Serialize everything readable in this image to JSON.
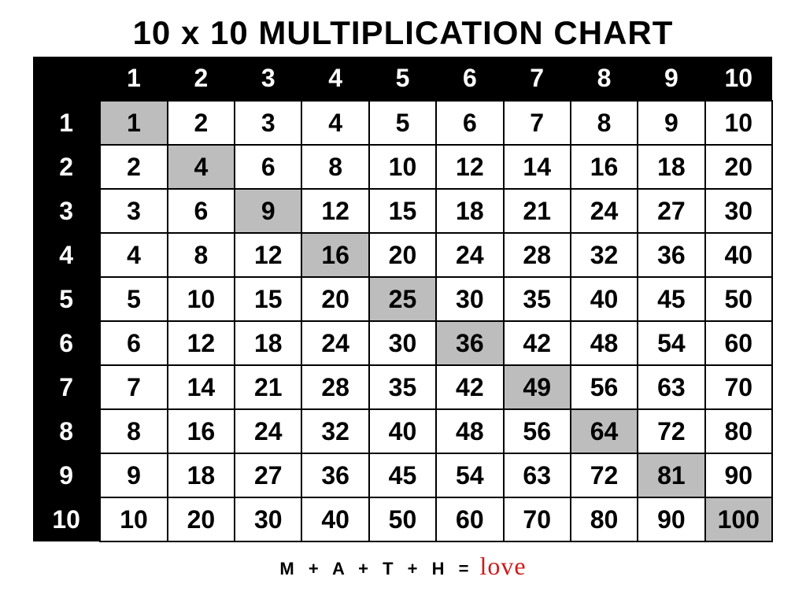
{
  "title": "10 x 10 MULTIPLICATION CHART",
  "size": 10,
  "col_headers": [
    "1",
    "2",
    "3",
    "4",
    "5",
    "6",
    "7",
    "8",
    "9",
    "10"
  ],
  "row_headers": [
    "1",
    "2",
    "3",
    "4",
    "5",
    "6",
    "7",
    "8",
    "9",
    "10"
  ],
  "rows": [
    [
      "1",
      "2",
      "3",
      "4",
      "5",
      "6",
      "7",
      "8",
      "9",
      "10"
    ],
    [
      "2",
      "4",
      "6",
      "8",
      "10",
      "12",
      "14",
      "16",
      "18",
      "20"
    ],
    [
      "3",
      "6",
      "9",
      "12",
      "15",
      "18",
      "21",
      "24",
      "27",
      "30"
    ],
    [
      "4",
      "8",
      "12",
      "16",
      "20",
      "24",
      "28",
      "32",
      "36",
      "40"
    ],
    [
      "5",
      "10",
      "15",
      "20",
      "25",
      "30",
      "35",
      "40",
      "45",
      "50"
    ],
    [
      "6",
      "12",
      "18",
      "24",
      "30",
      "36",
      "42",
      "48",
      "54",
      "60"
    ],
    [
      "7",
      "14",
      "21",
      "28",
      "35",
      "42",
      "49",
      "56",
      "63",
      "70"
    ],
    [
      "8",
      "16",
      "24",
      "32",
      "40",
      "48",
      "56",
      "64",
      "72",
      "80"
    ],
    [
      "9",
      "18",
      "27",
      "36",
      "45",
      "54",
      "63",
      "72",
      "81",
      "90"
    ],
    [
      "10",
      "20",
      "30",
      "40",
      "50",
      "60",
      "70",
      "80",
      "90",
      "100"
    ]
  ],
  "footer": {
    "left": "M + A + T + H =",
    "right": "love"
  }
}
